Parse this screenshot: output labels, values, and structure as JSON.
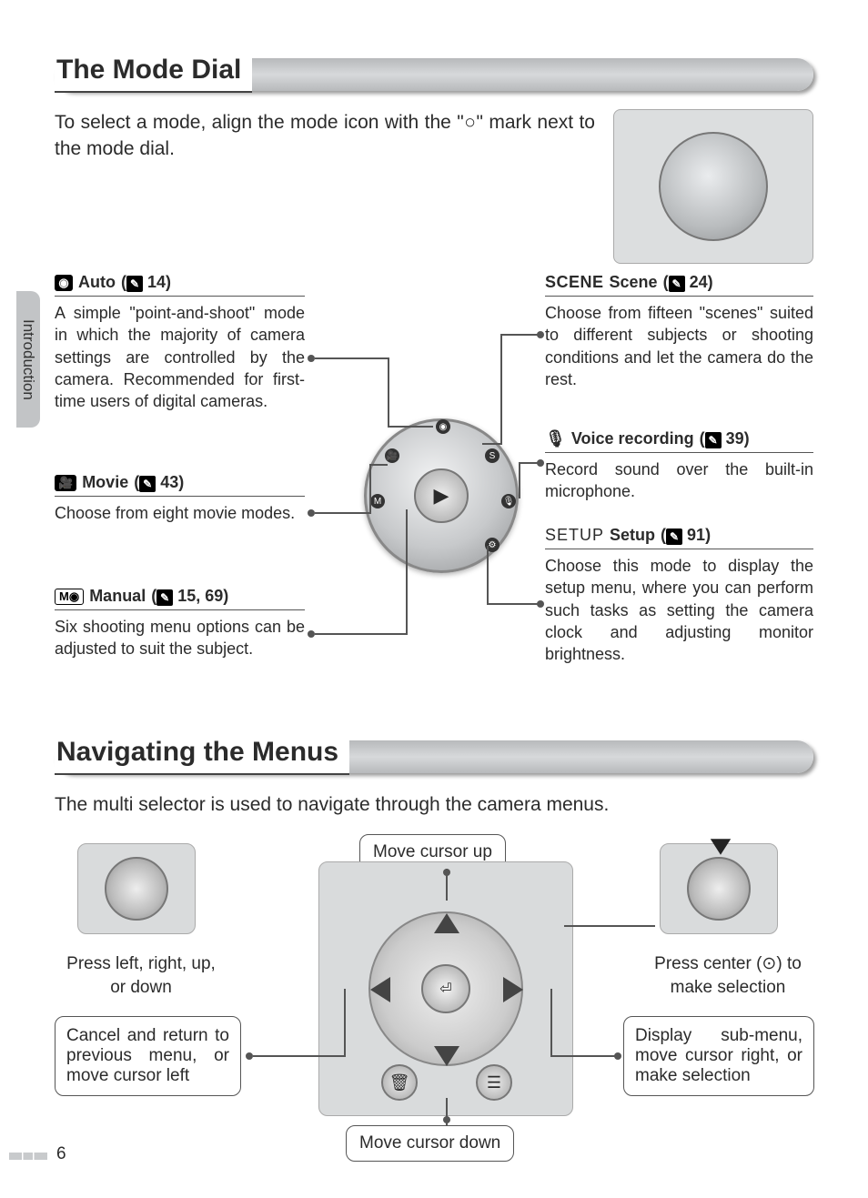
{
  "section_tab": "Introduction",
  "page_number": "6",
  "mode_dial": {
    "heading": "The Mode Dial",
    "intro": "To select a mode, align the mode icon with the \"○\" mark next to the mode dial.",
    "left": [
      {
        "icon": "●",
        "title": "Auto",
        "ref": "14",
        "body": "A simple \"point-and-shoot\" mode in which the majority of camera settings are controlled by the camera.  Recommended for first-time users of digital cameras."
      },
      {
        "icon": "🎥",
        "title": "Movie",
        "ref": "43",
        "body": "Choose from eight movie modes."
      },
      {
        "icon": "M●",
        "title": "Manual",
        "ref": "15, 69",
        "body": "Six shooting menu options can be adjusted to suit the subject."
      }
    ],
    "right": [
      {
        "prefix": "SCENE",
        "title": "Scene",
        "ref": "24",
        "body": "Choose from fifteen \"scenes\" suited to different subjects or shooting conditions and let the camera do the rest."
      },
      {
        "icon": "🎤",
        "title": "Voice recording",
        "ref": "39",
        "body": "Record sound over the built-in microphone."
      },
      {
        "prefix": "SETUP",
        "title": "Setup",
        "ref": "91",
        "body": "Choose this mode to display the setup menu, where you can perform such tasks as setting the camera clock and adjusting monitor brightness."
      }
    ]
  },
  "nav": {
    "heading": "Navigating the Menus",
    "intro": "The multi selector is used to navigate through the camera menus.",
    "labels": {
      "up": "Move cursor up",
      "down": "Move cursor down",
      "press_dir": "Press left, right, up, or down",
      "press_center": "Press center (⊙) to make selection",
      "cancel": "Cancel and return to previous menu, or move cursor left",
      "submenu": "Display sub-menu, move cursor right, or make selection"
    }
  }
}
